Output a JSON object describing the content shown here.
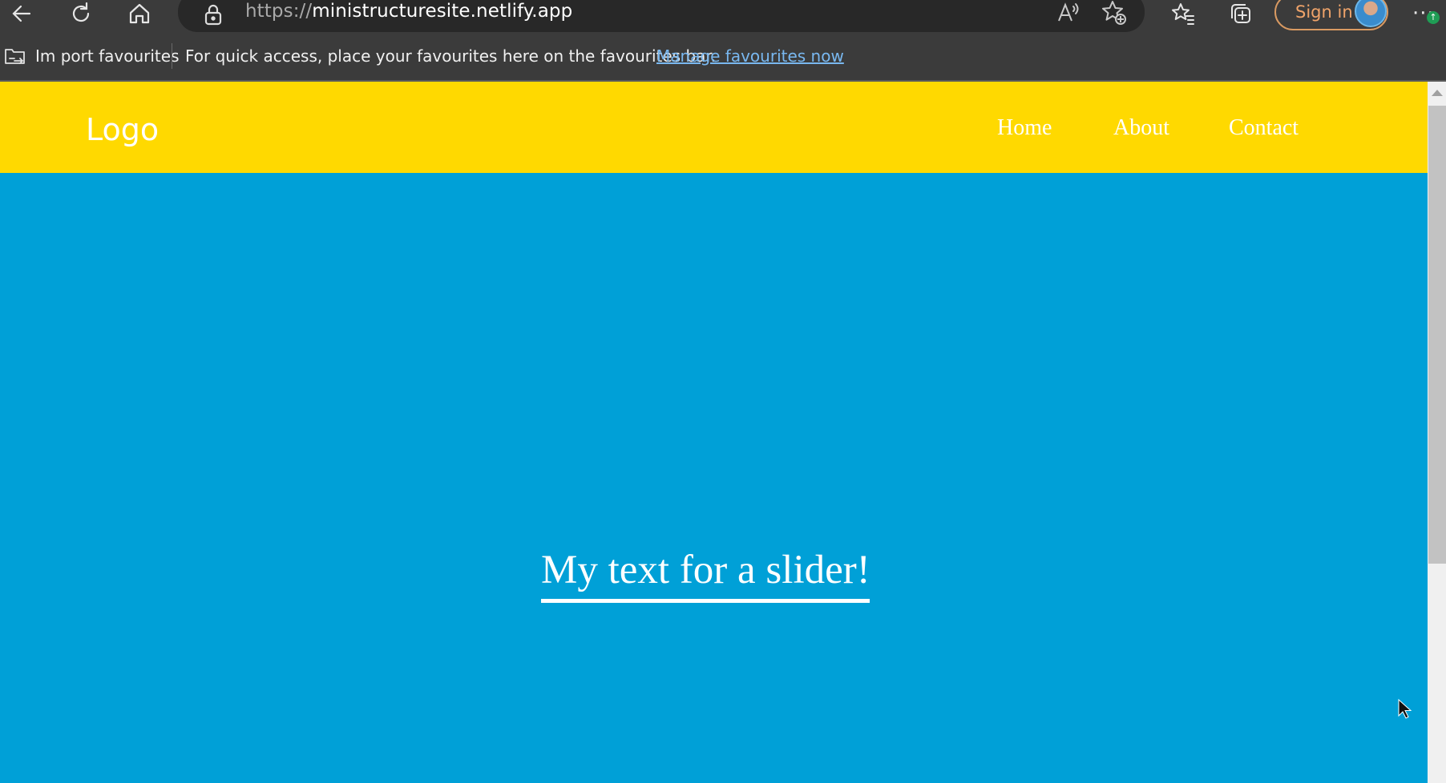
{
  "browser": {
    "url_scheme": "https://",
    "url_host": "ministructuresite.netlify.app",
    "sign_in_label": "Sign in",
    "more_label": "···"
  },
  "favourites_bar": {
    "import_label": "Im port favourites",
    "message": "For quick access, place your favourites here on the favourites bar.",
    "manage_link": "Manage favourites now"
  },
  "site": {
    "logo": "Logo",
    "nav": [
      {
        "label": "Home"
      },
      {
        "label": "About"
      },
      {
        "label": "Contact"
      }
    ],
    "hero_text": "My text for a slider!"
  },
  "colors": {
    "header_bg": "#ffd900",
    "hero_bg": "#00a0d7",
    "chrome_bg": "#3b3b3b",
    "link": "#79b8f0",
    "signin_accent": "#f0a46a"
  }
}
